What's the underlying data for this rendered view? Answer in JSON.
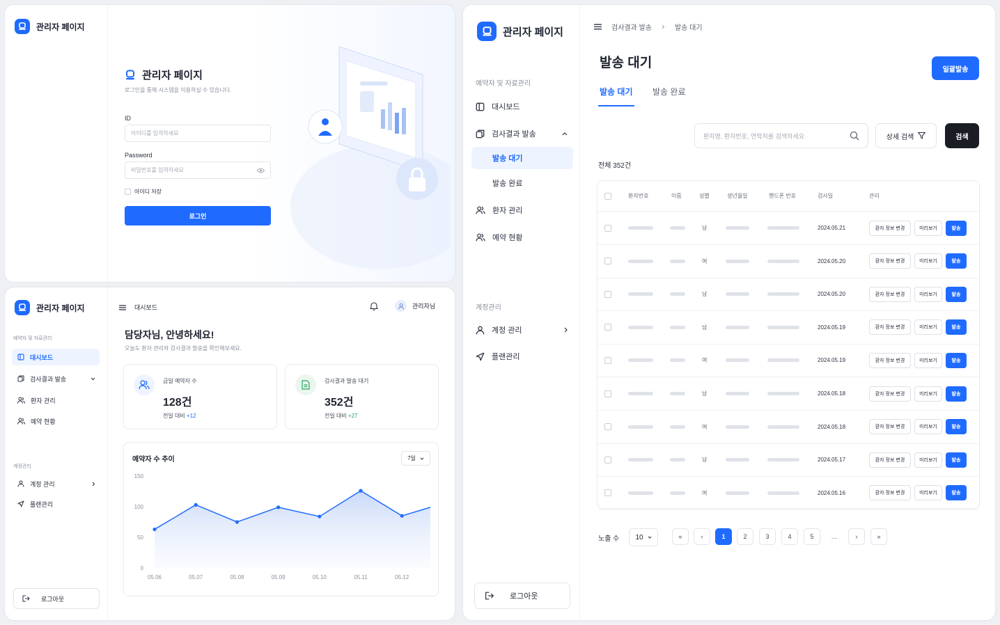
{
  "brand": {
    "name": "관리자 페이지"
  },
  "login": {
    "title": "관리자 페이지",
    "subtitle": "로그인을 통해 시스템을 이용하실 수 있습니다.",
    "id_label": "ID",
    "id_placeholder": "아이디를 입력하세요",
    "pw_label": "Password",
    "pw_placeholder": "비밀번호를 입력하세요",
    "remember_label": "아이디 저장",
    "login_button": "로그인"
  },
  "dashboard": {
    "sidebar": {
      "section1": "예약자 및 자료관리",
      "items": [
        "대시보드",
        "검사결과 발송",
        "환자 관리",
        "예약 현황"
      ],
      "section2": "계정관리",
      "items2": [
        "계정 관리",
        "플랜관리"
      ],
      "logout": "로그아웃"
    },
    "header": {
      "breadcrumb": "대시보드",
      "user": "관리자님"
    },
    "greeting": "담당자님, 안녕하세요!",
    "greeting_sub": "오늘도 환자 관리와 검사결과 발송을 확인해보세요.",
    "stats": [
      {
        "label": "금일 예약자 수",
        "value": "128건",
        "delta_prefix": "전일 대비",
        "delta": "+12"
      },
      {
        "label": "검사결과 발송 대기",
        "value": "352건",
        "delta_prefix": "전일 대비",
        "delta": "+27"
      }
    ],
    "chart_title": "예약자 수 추이",
    "range_select": "7일"
  },
  "chart_data": {
    "type": "area",
    "title": "예약자 수 추이",
    "x": [
      "05.06",
      "05.07",
      "05.08",
      "05.09",
      "05.10",
      "05.11",
      "05.12"
    ],
    "series": [
      {
        "values": [
          63,
          103,
          75,
          99,
          84,
          126,
          85
        ]
      }
    ],
    "extra_point_right": 99,
    "yticks": [
      0,
      50,
      100,
      150
    ],
    "ylim": [
      0,
      150
    ],
    "grid": false
  },
  "list": {
    "breadcrumb": [
      "검사결과 발송",
      "발송 대기"
    ],
    "sidebar": {
      "section1": "예약자 및 자료관리",
      "dashboard": "대시보드",
      "send": "검사결과 발송",
      "sub": [
        "발송 대기",
        "발송 완료"
      ],
      "patient": "환자 관리",
      "reservation": "예약 현황",
      "section2": "계정관리",
      "account": "계정 관리",
      "plan": "플랜관리",
      "logout": "로그아웃"
    },
    "title": "발송 대기",
    "bulk_button": "일괄발송",
    "tabs": [
      "발송 대기",
      "발송 완료"
    ],
    "search_placeholder": "환자명, 환자번호, 연락처를 검색하세요",
    "detail_search": "상세 검색",
    "search_button": "검색",
    "total": "전체 352건",
    "columns": [
      "환자번호",
      "이름",
      "성별",
      "생년월일",
      "핸드폰 번호",
      "검사일",
      "관리"
    ],
    "rows": [
      {
        "gender": "남",
        "date": "2024.05.21"
      },
      {
        "gender": "여",
        "date": "2024.05.20"
      },
      {
        "gender": "남",
        "date": "2024.05.20"
      },
      {
        "gender": "남",
        "date": "2024.05.19"
      },
      {
        "gender": "여",
        "date": "2024.05.19"
      },
      {
        "gender": "남",
        "date": "2024.05.18"
      },
      {
        "gender": "여",
        "date": "2024.05.18"
      },
      {
        "gender": "남",
        "date": "2024.05.17"
      },
      {
        "gender": "여",
        "date": "2024.05.16"
      }
    ],
    "row_actions": [
      "환자 정보 변경",
      "미리보기",
      "발송"
    ],
    "page_size_label": "노출 수",
    "page_size": "10",
    "pages": [
      "1",
      "2",
      "3",
      "4",
      "5",
      "…"
    ],
    "page_nav": [
      "«",
      "‹",
      "›",
      "»"
    ]
  }
}
